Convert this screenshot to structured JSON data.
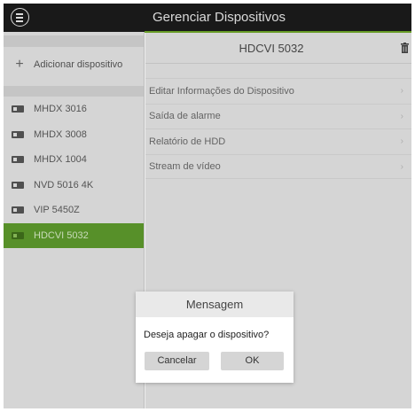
{
  "header": {
    "title": "Gerenciar Dispositivos",
    "menu_icon": "menu-icon"
  },
  "sidebar": {
    "add_label": "Adicionar dispositivo",
    "devices": [
      {
        "name": "MHDX 3016",
        "selected": false
      },
      {
        "name": "MHDX 3008",
        "selected": false
      },
      {
        "name": "MHDX 1004",
        "selected": false
      },
      {
        "name": "NVD 5016 4K",
        "selected": false
      },
      {
        "name": "VIP 5450Z",
        "selected": false
      },
      {
        "name": "HDCVI 5032",
        "selected": true
      }
    ]
  },
  "detail": {
    "title": "HDCVI 5032",
    "options": [
      "Editar Informações do Dispositivo",
      "Saída de alarme",
      "Relatório de HDD",
      "Stream de vídeo"
    ]
  },
  "dialog": {
    "title": "Mensagem",
    "message": "Deseja apagar o dispositivo?",
    "cancel_label": "Cancelar",
    "ok_label": "OK"
  },
  "colors": {
    "accent": "#5d9a2c",
    "header_bg": "#1b1b1b",
    "panel_bg": "#e3e3e3"
  }
}
